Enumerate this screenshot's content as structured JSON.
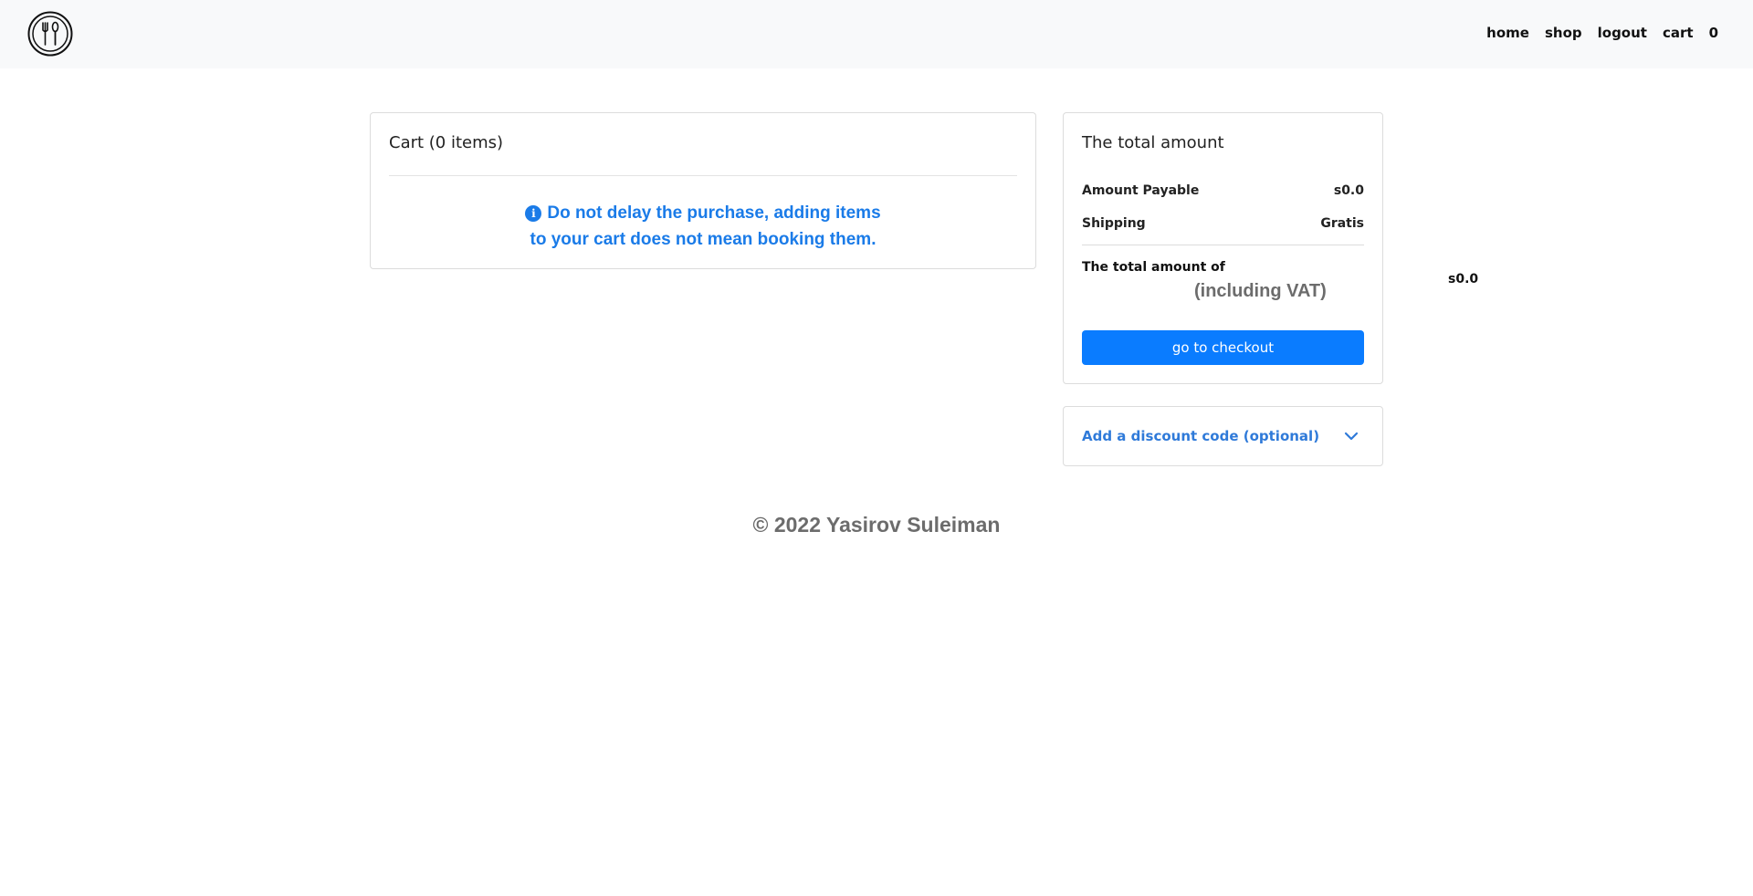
{
  "nav": {
    "logo_icon": "fork-spoon-knife-icon",
    "links": [
      "home",
      "shop",
      "logout",
      "cart",
      "0"
    ]
  },
  "cart": {
    "title": "Cart (0 items)",
    "notice_icon": "info-icon",
    "notice_line1": "Do not delay the purchase, adding items",
    "notice_line2": "to your cart does not mean booking them."
  },
  "summary": {
    "title": "The total amount",
    "payable_label": "Amount Payable",
    "payable_value": "s0.0",
    "shipping_label": "Shipping",
    "shipping_value": "Gratis",
    "total_label": "The total amount of",
    "vat_label": "(including VAT)",
    "total_value": "s0.0",
    "checkout_label": "go to checkout"
  },
  "discount": {
    "label": "Add a discount code (optional)",
    "icon": "chevron-down-icon"
  },
  "footer": {
    "text": "© 2022 Yasirov Suleiman"
  },
  "colors": {
    "accent": "#0a7cff",
    "notice": "#1a7be8",
    "navbar_bg": "#f8f9fa"
  }
}
